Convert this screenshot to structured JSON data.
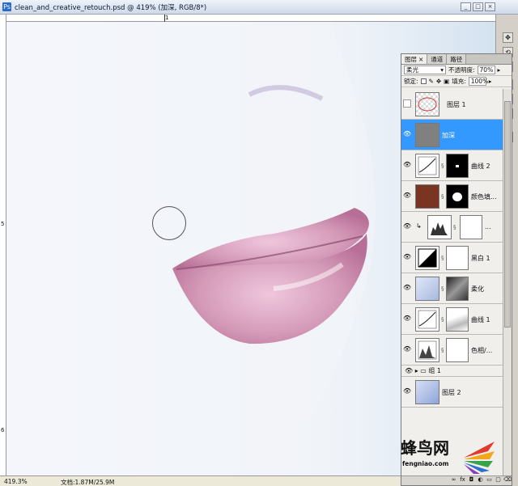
{
  "window": {
    "app_icon": "Ps",
    "title": "clean_and_creative_retouch.psd @ 419% (加深, RGB/8*)",
    "min_label": "_",
    "max_label": "□",
    "close_label": "×"
  },
  "ruler": {
    "top_marks": [
      "1"
    ],
    "left_marks": [
      "5",
      "6"
    ]
  },
  "status": {
    "zoom": "419.3%",
    "doc_info": "文档:1.87M/25.9M"
  },
  "layers_panel": {
    "tabs": [
      {
        "label": "图层",
        "close": "×"
      },
      {
        "label": "通道"
      },
      {
        "label": "路径"
      }
    ],
    "blend_mode": "柔光",
    "opacity_label": "不透明度:",
    "opacity_value": "70%",
    "lock_label": "锁定:",
    "fill_label": "填充:",
    "fill_value": "100%",
    "layers": [
      {
        "name": "图层 1",
        "visible": false,
        "selected": false
      },
      {
        "name": "加深",
        "visible": true,
        "selected": true
      },
      {
        "name": "曲线 2",
        "visible": true
      },
      {
        "name": "颜色填...",
        "visible": true
      },
      {
        "name": "...",
        "visible": true
      },
      {
        "name": "黑白 1",
        "visible": true
      },
      {
        "name": "柔化",
        "visible": true
      },
      {
        "name": "曲线 1",
        "visible": true
      },
      {
        "name": "色相/...",
        "visible": true
      },
      {
        "name": "组 1",
        "visible": true,
        "group": true
      },
      {
        "name": "图层 2",
        "visible": true
      }
    ],
    "bottom_icons": [
      "link-icon",
      "fx-icon",
      "mask-icon",
      "adjustment-icon",
      "folder-icon",
      "new-layer-icon",
      "trash-icon"
    ]
  },
  "right_tools": [
    "move-icon",
    "history-icon",
    "brush-preset-icon",
    "swatch-icon",
    "text-icon",
    "paragraph-icon",
    "clone-icon"
  ],
  "watermark": {
    "cn": "蜂鸟网",
    "en": "fengniao.com"
  },
  "colors": {
    "selected_layer": "#3399ff",
    "fill_layer": "#7a3422",
    "lip": "#d49ab8"
  }
}
